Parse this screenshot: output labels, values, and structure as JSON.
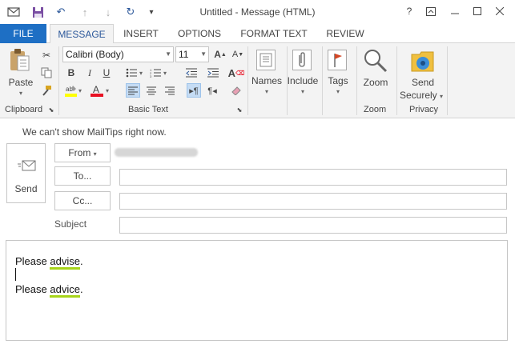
{
  "window": {
    "title": "Untitled - Message (HTML)",
    "help_label": "?"
  },
  "tabs": [
    "FILE",
    "MESSAGE",
    "INSERT",
    "OPTIONS",
    "FORMAT TEXT",
    "REVIEW"
  ],
  "ribbon": {
    "clipboard": {
      "paste_label": "Paste",
      "group_label": "Clipboard"
    },
    "basic_text": {
      "font_name": "Calibri (Body)",
      "font_size": "11",
      "group_label": "Basic Text",
      "bold": "B",
      "italic": "I",
      "underline": "U"
    },
    "names_label": "Names",
    "include_label": "Include",
    "tags_label": "Tags",
    "zoom": {
      "label": "Zoom",
      "group_label": "Zoom"
    },
    "privacy": {
      "send_label_1": "Send",
      "send_label_2": "Securely",
      "group_label": "Privacy"
    }
  },
  "mailtips": "We can't show MailTips right now.",
  "header": {
    "send_label": "Send",
    "from_label": "From",
    "to_label": "To...",
    "cc_label": "Cc...",
    "subject_label": "Subject"
  },
  "body": {
    "line1_prefix": "Please ",
    "line1_word": "advise",
    "line1_suffix": ".",
    "line2_prefix": "Please ",
    "line2_word": "advice",
    "line2_suffix": "."
  },
  "colors": {
    "file_tab": "#1e6fc4",
    "accent": "#2b579a",
    "grammar_squiggle": "#a7d41a",
    "highlight_yellow": "#ffff00",
    "font_red": "#e81123"
  }
}
